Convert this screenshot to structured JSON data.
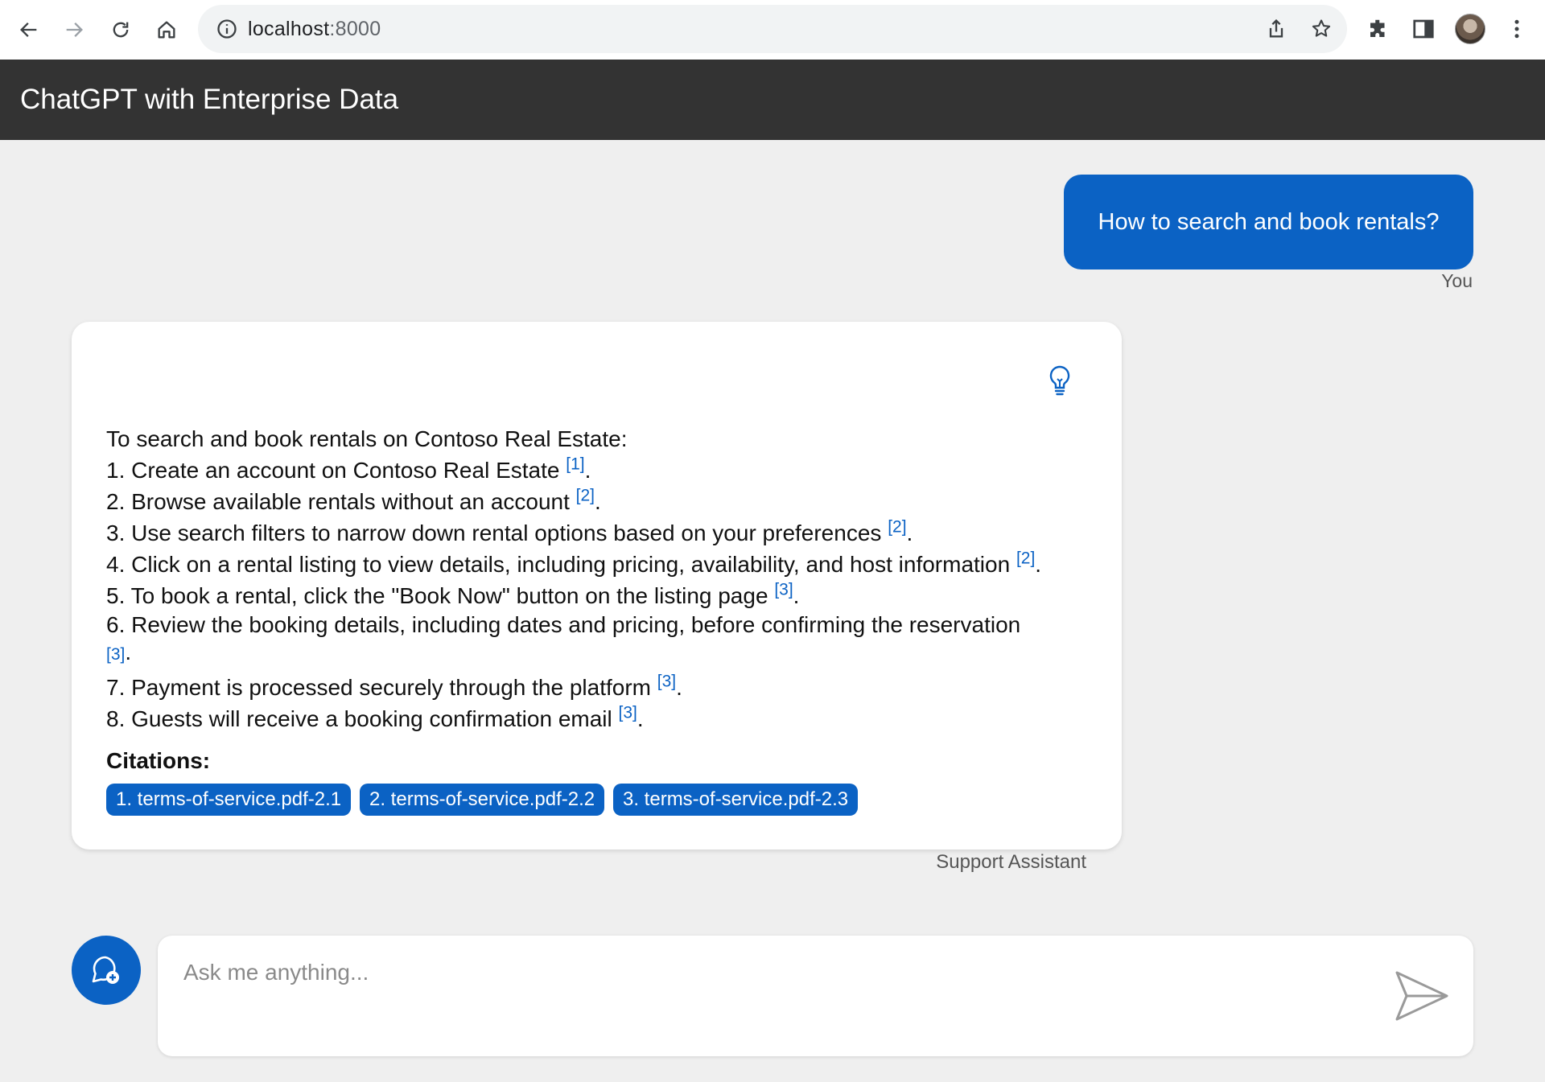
{
  "browser": {
    "url_host": "localhost",
    "url_port": ":8000"
  },
  "app": {
    "title": "ChatGPT with Enterprise Data"
  },
  "user_message": {
    "text": "How to search and book rentals?",
    "sender": "You"
  },
  "assistant_message": {
    "intro": "To search and book rentals on Contoso Real Estate:",
    "steps": [
      {
        "text": "1. Create an account on Contoso Real Estate ",
        "cite": "[1]"
      },
      {
        "text": "2. Browse available rentals without an account ",
        "cite": "[2]"
      },
      {
        "text": "3. Use search filters to narrow down rental options based on your preferences ",
        "cite": "[2]"
      },
      {
        "text": "4. Click on a rental listing to view details, including pricing, availability, and host information ",
        "cite": "[2]"
      },
      {
        "text": "5. To book a rental, click the \"Book Now\" button on the listing page ",
        "cite": "[3]"
      },
      {
        "text": "6. Review the booking details, including dates and pricing, before confirming the reservation",
        "cite": "[3]"
      },
      {
        "text": "7. Payment is processed securely through the platform ",
        "cite": "[3]"
      },
      {
        "text": "8. Guests will receive a booking confirmation email ",
        "cite": "[3]"
      }
    ],
    "citations_title": "Citations:",
    "citations": [
      "1. terms-of-service.pdf-2.1",
      "2. terms-of-service.pdf-2.2",
      "3. terms-of-service.pdf-2.3"
    ],
    "sender": "Support Assistant"
  },
  "composer": {
    "placeholder": "Ask me anything..."
  },
  "colors": {
    "accent": "#0b62c4",
    "header_bg": "#333333",
    "page_bg": "#efefef"
  }
}
